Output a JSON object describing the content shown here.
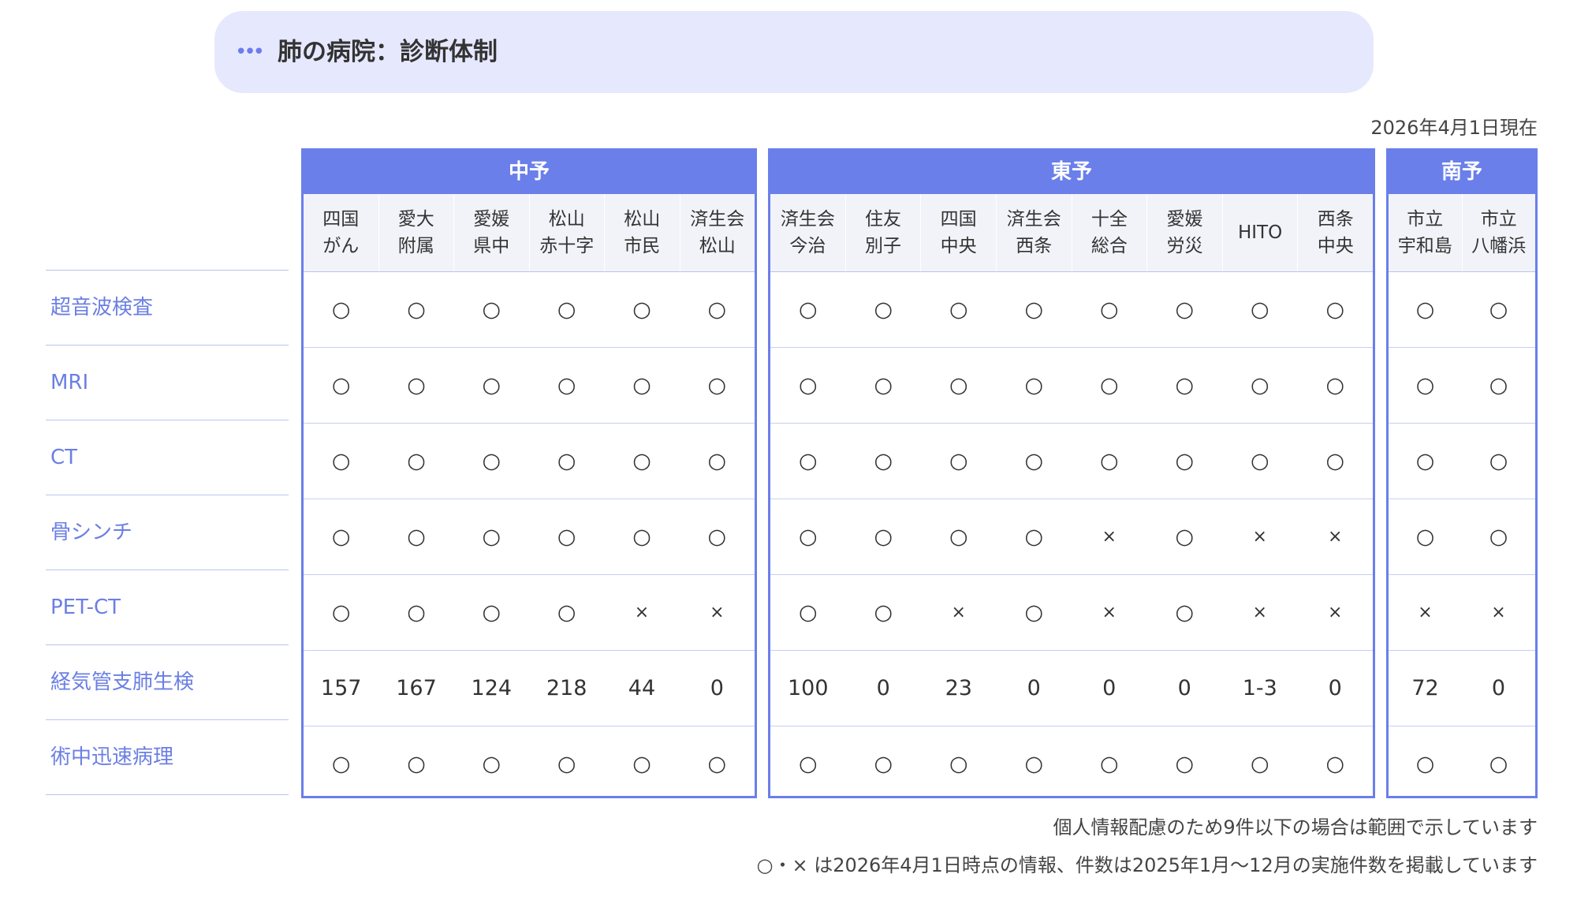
{
  "header": {
    "icon": "ellipsis-icon",
    "title": "肺の病院：診断体制"
  },
  "as_of": "2026年4月1日現在",
  "row_labels": [
    "超音波検査",
    "MRI",
    "CT",
    "骨シンチ",
    "PET-CT",
    "経気管支肺生検",
    "術中迅速病理"
  ],
  "regions": [
    {
      "name": "中予",
      "hospitals": [
        "四国\nがん",
        "愛大\n附属",
        "愛媛\n県中",
        "松山\n赤十字",
        "松山\n市民",
        "済生会\n松山"
      ],
      "rows": [
        [
          "○",
          "○",
          "○",
          "○",
          "○",
          "○"
        ],
        [
          "○",
          "○",
          "○",
          "○",
          "○",
          "○"
        ],
        [
          "○",
          "○",
          "○",
          "○",
          "○",
          "○"
        ],
        [
          "○",
          "○",
          "○",
          "○",
          "○",
          "○"
        ],
        [
          "○",
          "○",
          "○",
          "○",
          "×",
          "×"
        ],
        [
          "157",
          "167",
          "124",
          "218",
          "44",
          "0"
        ],
        [
          "○",
          "○",
          "○",
          "○",
          "○",
          "○"
        ]
      ]
    },
    {
      "name": "東予",
      "hospitals": [
        "済生会\n今治",
        "住友\n別子",
        "四国\n中央",
        "済生会\n西条",
        "十全\n総合",
        "愛媛\n労災",
        "HITO",
        "西条\n中央"
      ],
      "rows": [
        [
          "○",
          "○",
          "○",
          "○",
          "○",
          "○",
          "○",
          "○"
        ],
        [
          "○",
          "○",
          "○",
          "○",
          "○",
          "○",
          "○",
          "○"
        ],
        [
          "○",
          "○",
          "○",
          "○",
          "○",
          "○",
          "○",
          "○"
        ],
        [
          "○",
          "○",
          "○",
          "○",
          "×",
          "○",
          "×",
          "×"
        ],
        [
          "○",
          "○",
          "×",
          "○",
          "×",
          "○",
          "×",
          "×"
        ],
        [
          "100",
          "0",
          "23",
          "0",
          "0",
          "0",
          "1-3",
          "0"
        ],
        [
          "○",
          "○",
          "○",
          "○",
          "○",
          "○",
          "○",
          "○"
        ]
      ]
    },
    {
      "name": "南予",
      "hospitals": [
        "市立\n宇和島",
        "市立\n八幡浜"
      ],
      "rows": [
        [
          "○",
          "○"
        ],
        [
          "○",
          "○"
        ],
        [
          "○",
          "○"
        ],
        [
          "○",
          "○"
        ],
        [
          "×",
          "×"
        ],
        [
          "72",
          "0"
        ],
        [
          "○",
          "○"
        ]
      ]
    }
  ],
  "notes": [
    "個人情報配慮のため9件以下の場合は範囲で示しています",
    "○・× は2026年4月1日時点の情報、件数は2025年1月～12月の実施件数を掲載しています"
  ],
  "colors": {
    "accent": "#6a7fea",
    "banner_bg": "#e6e8fd",
    "row_label": "#6b7fe3"
  }
}
